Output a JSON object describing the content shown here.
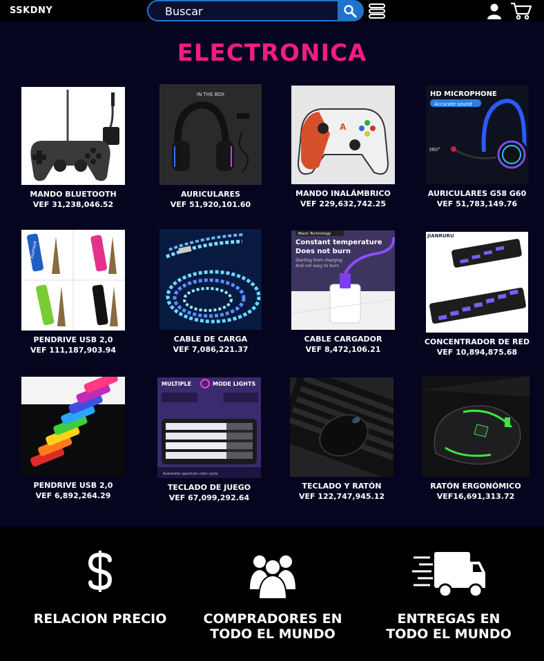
{
  "header": {
    "logo": "SSKDNY",
    "search_placeholder": "Buscar"
  },
  "main": {
    "title": "ELECTRONICA",
    "products": [
      {
        "name": "MANDO BLUETOOTH",
        "price": "VEF 31,238,046.52",
        "image": "gamepad-image"
      },
      {
        "name": "AURICULARES",
        "price": "VEF 51,920,101.60",
        "image": "headset-image"
      },
      {
        "name": "MANDO INALÁMBRICO",
        "price": "VEF 229,632,742.25",
        "image": "controller-image"
      },
      {
        "name": "AURICULARES G58 G60",
        "price": "VEF 51,783,149.76",
        "image": "rgb-headset-image"
      },
      {
        "name": "PENDRIVE USB 2,0",
        "price": "VEF 111,187,903.94",
        "image": "usb-drives-image"
      },
      {
        "name": "CABLE DE CARGA",
        "price": "VEF 7,086,221.37",
        "image": "led-cable-image"
      },
      {
        "name": "CABLE CARGADOR",
        "price": "VEF 8,472,106.21",
        "image": "charger-image"
      },
      {
        "name": "CONCENTRADOR DE RED",
        "price": "VEF 10,894,875.68",
        "image": "usb-hub-image"
      },
      {
        "name": "PENDRIVE USB 2,0",
        "price": "VEF 6,892,264.29",
        "image": "color-usb-image"
      },
      {
        "name": "TECLADO DE JUEGO",
        "price": "VEF 67,099,292.64",
        "image": "keyboard-image"
      },
      {
        "name": "TECLADO Y RATÓN",
        "price": "VEF 122,747,945.12",
        "image": "keyboard-mouse-image"
      },
      {
        "name": "RATÓN ERGONÓMICO",
        "price": "VEF16,691,313.72",
        "image": "gaming-mouse-image"
      }
    ],
    "image_texts": {
      "headset_box": "IN THE BOX",
      "mic_title": "HD MICROPHONE",
      "mic_badge": "Accurate sound",
      "mic_360": "360°",
      "usb_brand": "Xiumeya",
      "charger_tag": "Black Technology",
      "charger_line1": "Constant temperature",
      "charger_line2": "Does not burn",
      "charger_sub1": "Starting from charging",
      "charger_sub2": "And not easy to burn",
      "hub_brand": "JIANRURU",
      "kb_banner": "MULTIPLE",
      "kb_banner2": "MODE LIGHTS",
      "kb_caption": "Automatic spectrum color cycle"
    }
  },
  "footer": {
    "features": [
      {
        "label_line1": "RELACION PRECIO",
        "label_line2": "",
        "icon": "dollar-icon"
      },
      {
        "label_line1": "COMPRADORES EN",
        "label_line2": "TODO EL MUNDO",
        "icon": "people-icon"
      },
      {
        "label_line1": "ENTREGAS EN",
        "label_line2": "TODO EL MUNDO",
        "icon": "delivery-truck-icon"
      }
    ]
  },
  "colors": {
    "accent": "#f21d7e",
    "search_border": "#1e78d6",
    "main_bg": "#050520"
  }
}
